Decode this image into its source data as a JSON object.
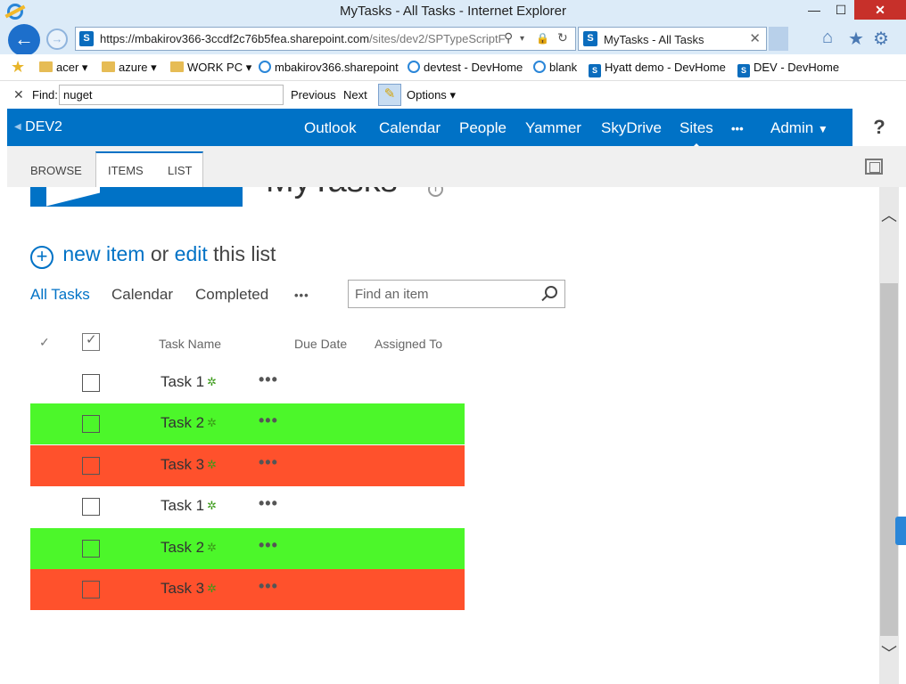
{
  "window": {
    "title": "MyTasks - All Tasks - Internet Explorer",
    "minimize": "—",
    "maximize": "☐",
    "close": "✕"
  },
  "browser": {
    "back": "←",
    "forward": "→",
    "url_main": "https://mbakirov366-3ccdf2c76b5fea.sharepoint.com",
    "url_rest": "/sites/dev2/SPTypeScriptF",
    "tab_title": "MyTasks - All Tasks",
    "tab_close": "✕",
    "home_icon": "⌂",
    "star_icon": "★",
    "gear_icon": "⚙",
    "search_icon": "⚲",
    "lock_icon": "🔒",
    "refresh_icon": "↻",
    "dropdown": "▾"
  },
  "favorites": [
    {
      "label": "acer",
      "icon": "folder",
      "menu": true
    },
    {
      "label": "azure",
      "icon": "folder",
      "menu": true
    },
    {
      "label": "WORK PC",
      "icon": "folder",
      "menu": true
    },
    {
      "label": "mbakirov366.sharepoint",
      "icon": "page"
    },
    {
      "label": "devtest - DevHome",
      "icon": "page"
    },
    {
      "label": "blank",
      "icon": "page"
    },
    {
      "label": "Hyatt demo - DevHome",
      "icon": "sharepoint"
    },
    {
      "label": "DEV - DevHome",
      "icon": "sharepoint"
    }
  ],
  "find": {
    "close": "✕",
    "label": "Find:",
    "value": "nuget",
    "previous": "Previous",
    "next": "Next",
    "options": "Options"
  },
  "suite": {
    "site": "DEV2",
    "links": [
      "Outlook",
      "Calendar",
      "People",
      "Yammer",
      "SkyDrive",
      "Sites"
    ],
    "active": "Sites",
    "more": "•••",
    "admin": "Admin",
    "help": "?"
  },
  "ribbon": {
    "tabs": [
      "BROWSE",
      "ITEMS",
      "LIST"
    ]
  },
  "page": {
    "title": "MyTasks",
    "info": "i",
    "new_item": "new item",
    "or": "or",
    "edit": "edit",
    "this_list": "this list",
    "views": [
      "All Tasks",
      "Calendar",
      "Completed"
    ],
    "active_view": "All Tasks",
    "views_more": "•••",
    "search_placeholder": "Find an item",
    "columns": {
      "check": "✓",
      "task_name": "Task Name",
      "due_date": "Due Date",
      "assigned_to": "Assigned To"
    }
  },
  "rows": [
    {
      "name": "Task 1",
      "new_mark": "✲",
      "menu": "•••",
      "color": "#ffffff"
    },
    {
      "name": "Task 2",
      "new_mark": "✲",
      "menu": "•••",
      "color": "#4cf72a"
    },
    {
      "name": "Task 3",
      "new_mark": "✲",
      "menu": "•••",
      "color": "#ff512c"
    },
    {
      "name": "Task 1",
      "new_mark": "✲",
      "menu": "•••",
      "color": "#ffffff"
    },
    {
      "name": "Task 2",
      "new_mark": "✲",
      "menu": "•••",
      "color": "#4cf72a"
    },
    {
      "name": "Task 3",
      "new_mark": "✲",
      "menu": "•••",
      "color": "#ff512c"
    }
  ],
  "colors": {
    "sharepoint_blue": "#0072c6",
    "row_green": "#4cf72a",
    "row_red": "#ff512c"
  },
  "scroll": {
    "up": "︿",
    "down": "﹀"
  }
}
